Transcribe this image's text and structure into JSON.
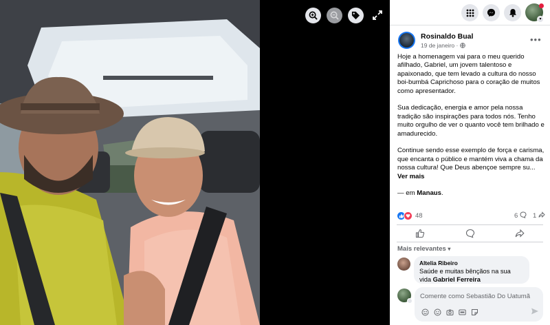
{
  "viewer": {
    "icons": [
      "zoom-in-icon",
      "zoom-out-icon",
      "tag-icon",
      "expand-icon"
    ]
  },
  "topbar": {
    "icons": [
      "menu-grid-icon",
      "messenger-icon",
      "bell-icon"
    ],
    "colors": {
      "notification": "#e41e3f",
      "brand": "#1877f2"
    }
  },
  "post": {
    "author": "Rosinaldo Bual",
    "date": "19 de janeiro",
    "date_separator": "·",
    "paragraphs": [
      "Hoje a homenagem vai para o meu querido afilhado, Gabriel, um jovem talentoso e apaixonado, que tem levado a cultura do nosso boi-bumbá Caprichoso para o coração de muitos como apresentador.",
      "Sua dedicação, energia e amor pela nossa tradição são inspirações para todos nós. Tenho muito orgulho de ver o quanto você tem brilhado e amadurecido."
    ],
    "last_paragraph": "Continue sendo esse exemplo de força e carisma, que encanta o público e mantém viva a chama da nossa cultura! Que Deus abençoe sempre su...",
    "see_more": "Ver mais",
    "location_prefix": "— em",
    "location": "Manaus",
    "location_suffix": "."
  },
  "stats": {
    "reactions": "48",
    "comments": "6",
    "shares": "1"
  },
  "comments": {
    "sort_label": "Mais relevantes",
    "items": [
      {
        "name": "Altelia Ribeiro",
        "text": "Saúde e muitas bênçãos na sua vida",
        "tag": "Gabriel Ferreira"
      }
    ],
    "composer_placeholder": "Comente como Sebastião Do Uatumã"
  }
}
